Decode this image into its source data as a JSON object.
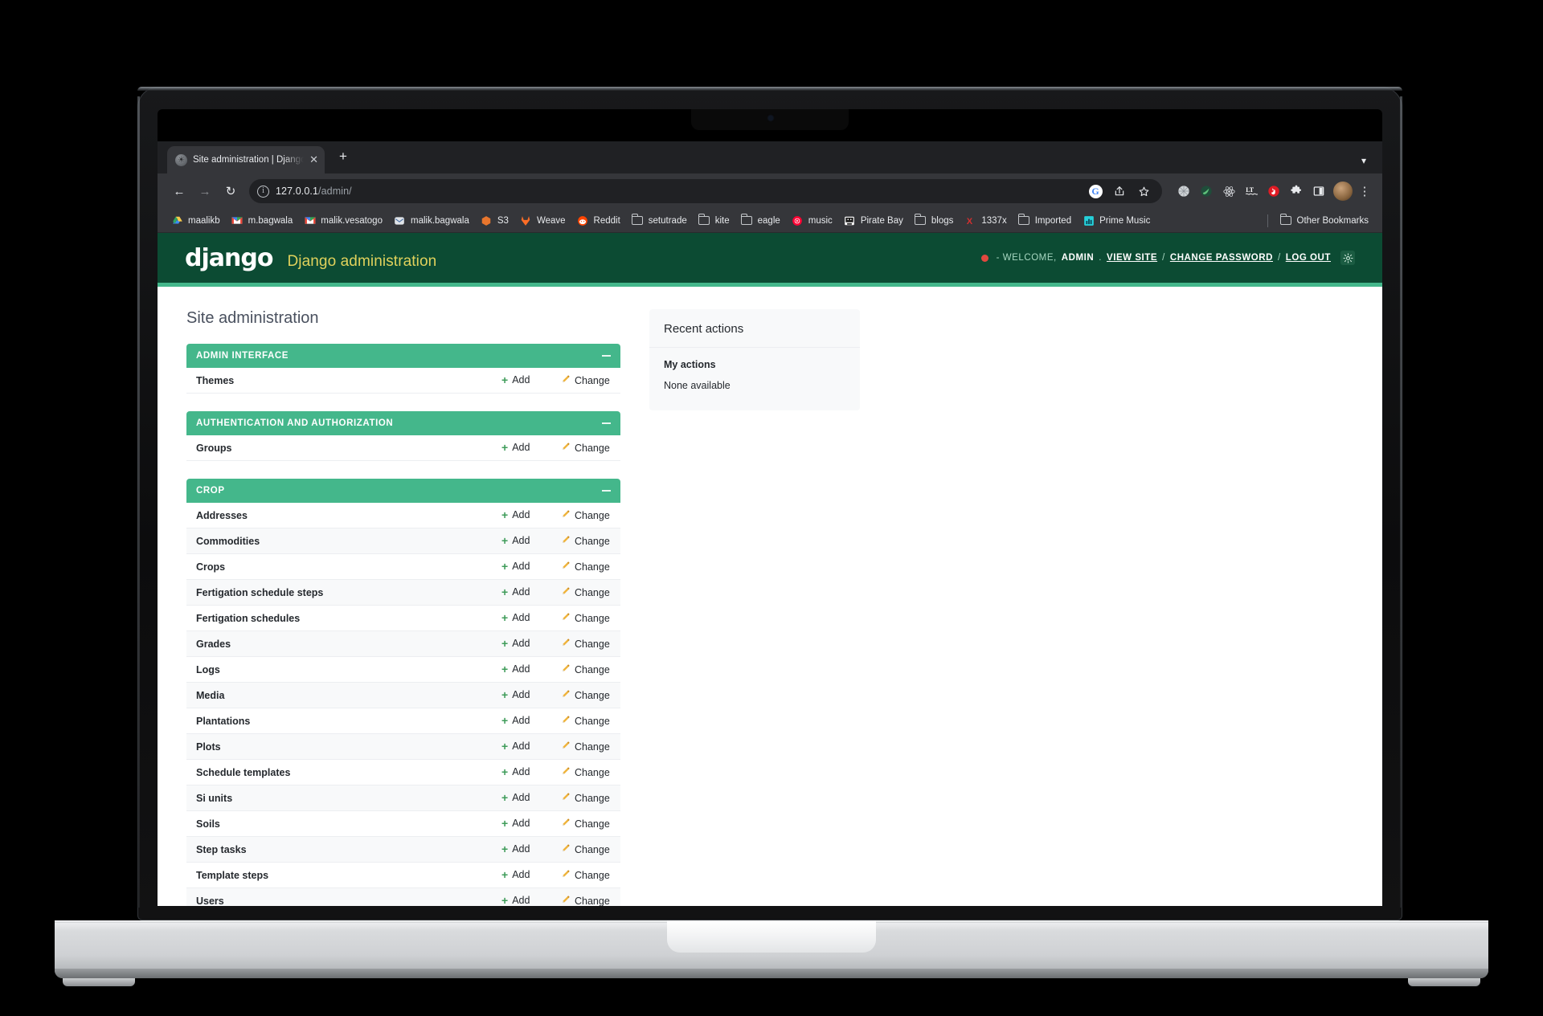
{
  "browser": {
    "tab": {
      "title": "Site administration | Django ad",
      "favicon_icon": "globe-icon",
      "close_icon": "close-icon"
    },
    "new_tab_label": "+",
    "tablist_chevron": "chevron-down-icon",
    "nav": {
      "back_icon": "arrow-left-icon",
      "forward_icon": "arrow-right-icon",
      "reload_icon": "reload-icon"
    },
    "omnibox": {
      "site_info_icon": "info-icon",
      "url_host": "127.0.0.1",
      "url_path": "/admin/",
      "google_lens_icon": "google-icon",
      "share_icon": "share-icon",
      "bookmark_icon": "star-icon"
    },
    "extensions": [
      {
        "name": "grid-extension-icon",
        "color": "#cfd3d6"
      },
      {
        "name": "weave-extension-icon",
        "color": "#2e9e5b"
      },
      {
        "name": "react-devtools-icon",
        "color": "#61dafb"
      },
      {
        "name": "languagetool-icon",
        "color": "#ffffff"
      },
      {
        "name": "adblock-extension-icon",
        "color": "#e01b24"
      },
      {
        "name": "puzzle-extensions-icon",
        "color": "#e8eaed"
      },
      {
        "name": "side-panel-icon",
        "color": "#e8eaed"
      }
    ],
    "profile_avatar": "avatar",
    "menu_icon": "kebab-menu-icon",
    "bookmarks": [
      {
        "label": "maalikb",
        "icon": "drive-icon"
      },
      {
        "label": "m.bagwala",
        "icon": "gmail-icon"
      },
      {
        "label": "malik.vesatogo",
        "icon": "gmail-icon"
      },
      {
        "label": "malik.bagwala",
        "icon": "mail-icon"
      },
      {
        "label": "S3",
        "icon": "aws-s3-icon"
      },
      {
        "label": "Weave",
        "icon": "gitlab-icon"
      },
      {
        "label": "Reddit",
        "icon": "reddit-icon"
      },
      {
        "label": "setutrade",
        "icon": "folder-icon"
      },
      {
        "label": "kite",
        "icon": "folder-icon"
      },
      {
        "label": "eagle",
        "icon": "folder-icon"
      },
      {
        "label": "music",
        "icon": "youtube-music-icon"
      },
      {
        "label": "Pirate Bay",
        "icon": "pirate-bay-icon"
      },
      {
        "label": "blogs",
        "icon": "folder-icon"
      },
      {
        "label": "1337x",
        "icon": "1337x-icon"
      },
      {
        "label": "Imported",
        "icon": "folder-icon"
      },
      {
        "label": "Prime Music",
        "icon": "prime-music-icon"
      }
    ],
    "other_bookmarks": {
      "label": "Other Bookmarks",
      "icon": "folder-icon"
    }
  },
  "django": {
    "logo_text": "django",
    "site_title": "Django administration",
    "user_tools": {
      "status_dot_color": "#e2483f",
      "welcome_prefix": "- WELCOME,",
      "username": "ADMIN",
      "period": ".",
      "view_site": "VIEW SITE",
      "sep1": "/",
      "change_password": "CHANGE PASSWORD",
      "sep2": "/",
      "log_out": "LOG OUT",
      "theme_toggle_icon": "theme-toggle-icon"
    },
    "accent_color": "#44B78B",
    "header_color": "#0C4B33",
    "page_title": "Site administration",
    "labels": {
      "add": "Add",
      "change": "Change",
      "collapse": "−"
    },
    "apps": [
      {
        "name": "ADMIN INTERFACE",
        "models": [
          {
            "name": "Themes"
          }
        ]
      },
      {
        "name": "AUTHENTICATION AND AUTHORIZATION",
        "models": [
          {
            "name": "Groups"
          }
        ]
      },
      {
        "name": "CROP",
        "models": [
          {
            "name": "Addresses"
          },
          {
            "name": "Commodities"
          },
          {
            "name": "Crops"
          },
          {
            "name": "Fertigation schedule steps"
          },
          {
            "name": "Fertigation schedules"
          },
          {
            "name": "Grades"
          },
          {
            "name": "Logs"
          },
          {
            "name": "Media"
          },
          {
            "name": "Plantations"
          },
          {
            "name": "Plots"
          },
          {
            "name": "Schedule templates"
          },
          {
            "name": "Si units"
          },
          {
            "name": "Soils"
          },
          {
            "name": "Step tasks"
          },
          {
            "name": "Template steps"
          },
          {
            "name": "Users"
          }
        ]
      }
    ],
    "recent_actions": {
      "title": "Recent actions",
      "subtitle": "My actions",
      "empty_text": "None available"
    }
  }
}
